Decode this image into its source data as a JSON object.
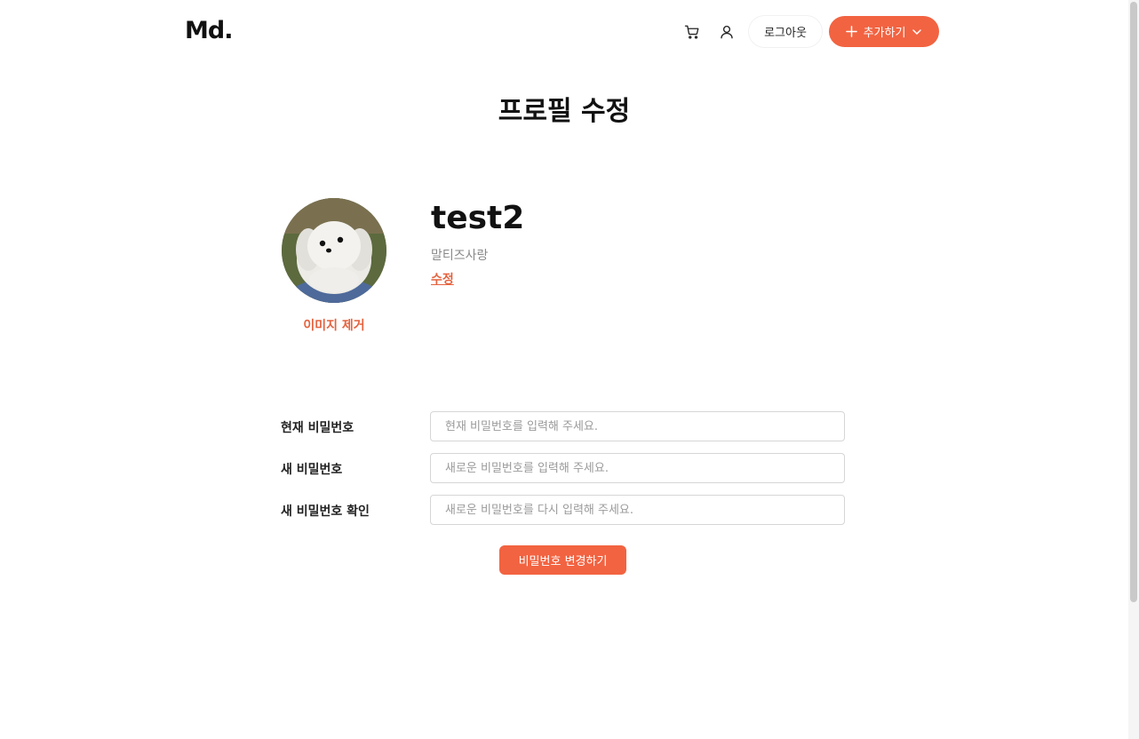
{
  "header": {
    "logo": "Md.",
    "icons": [
      "cart-icon",
      "user-icon",
      "plus-icon",
      "chevron-down-icon"
    ],
    "logout_label": "로그아웃",
    "add_label": "추가하기"
  },
  "page": {
    "title": "프로필 수정"
  },
  "profile": {
    "username": "test2",
    "bio": "말티즈사랑",
    "edit_label": "수정",
    "remove_image_label": "이미지 제거"
  },
  "password_form": {
    "current": {
      "label": "현재 비밀번호",
      "placeholder": "현재 비밀번호를 입력해 주세요."
    },
    "new": {
      "label": "새 비밀번호",
      "placeholder": "새로운 비밀번호를 입력해 주세요."
    },
    "confirm": {
      "label": "새 비밀번호 확인",
      "placeholder": "새로운 비밀번호를 다시 입력해 주세요."
    },
    "submit_label": "비밀번호 변경하기"
  },
  "colors": {
    "accent": "#f26341",
    "accent_text": "#e4633f",
    "muted": "#888888"
  }
}
